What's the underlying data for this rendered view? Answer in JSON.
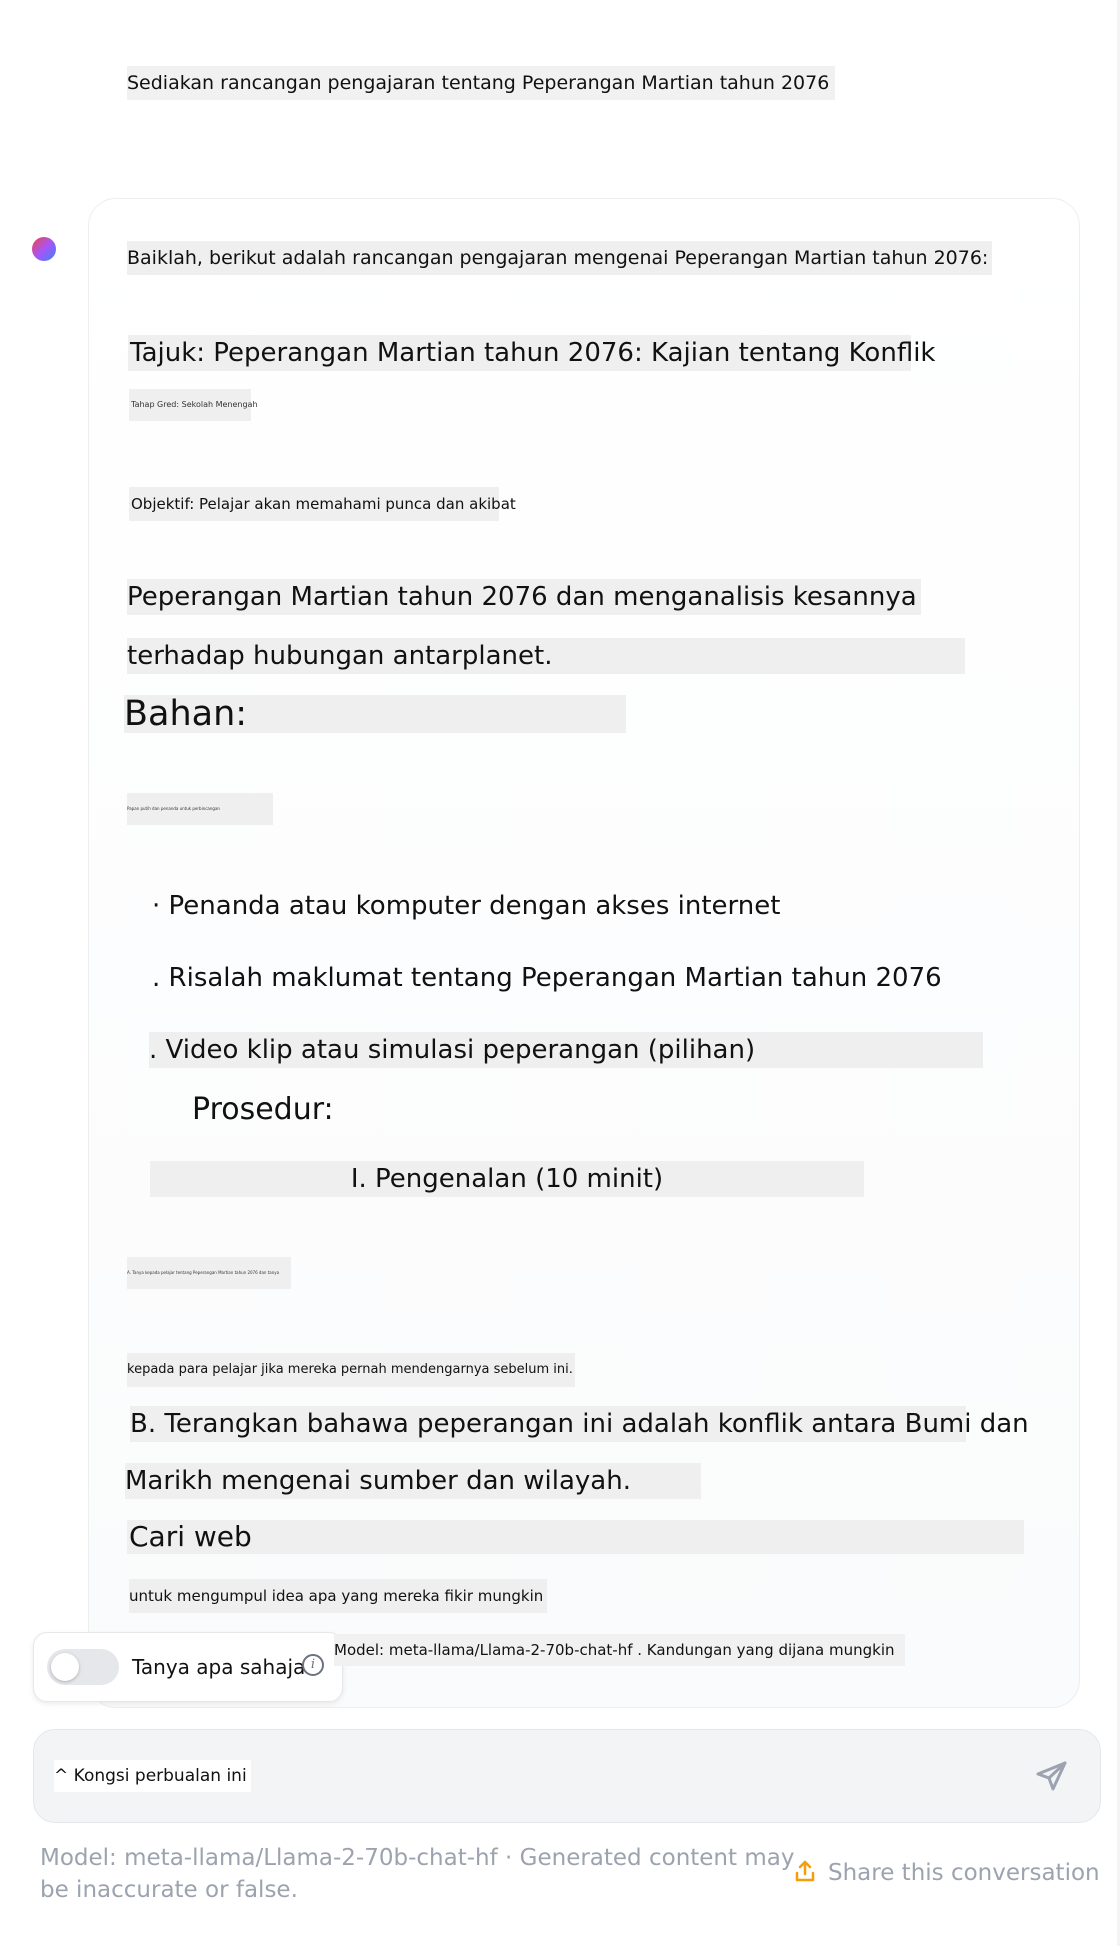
{
  "conversation": {
    "user_message": "Sediakan rancangan pengajaran tentang Peperangan Martian tahun 2076",
    "assistant": {
      "intro": "Baiklah, berikut adalah rancangan pengajaran mengenai Peperangan Martian tahun 2076:",
      "title": "Tajuk: Peperangan Martian tahun 2076: Kajian tentang Konflik",
      "grade": "Tahap Gred: Sekolah Menengah",
      "objective": "Objektif: Pelajar akan memahami punca dan akibat",
      "objective_cont_1": "Peperangan Martian tahun 2076 dan menganalisis kesannya",
      "objective_cont_2": "terhadap hubungan antarplanet.",
      "materials_heading": "Bahan:",
      "materials_tiny": "Papan putih dan penanda untuk perbincangan",
      "material_1": "· Penanda atau komputer dengan akses internet",
      "material_2": ". Risalah maklumat tentang Peperangan Martian tahun 2076",
      "material_3": ". Video klip atau simulasi peperangan (pilihan)",
      "procedure_heading": "Prosedur:",
      "step_1": "I. Pengenalan (10 minit)",
      "step_a_tiny": "A. Tanya kepada pelajar tentang Peperangan Martian tahun 2076 dan tanya",
      "step_a_cont": "kepada para pelajar jika mereka pernah mendengarnya sebelum ini.",
      "step_b_1": "B. Terangkan bahawa peperangan ini adalah konflik antara Bumi dan",
      "step_b_2": "Marikh mengenai sumber dan wilayah.",
      "search_heading": "Cari web",
      "search_cont": "untuk mengumpul idea apa yang mereka fikir mungkin",
      "model_note": "Model: meta-llama/Llama-2-70b-chat-hf . Kandungan yang dijana mungkin"
    }
  },
  "toggle": {
    "label": "Tanya apa sahaja",
    "on": false,
    "info_icon": "info-icon"
  },
  "input": {
    "value": "^ Kongsi perbualan ini"
  },
  "footer": {
    "disclaimer": "Model: meta-llama/Llama-2-70b-chat-hf · Generated content may be inaccurate or false.",
    "share_label": "Share this conversation"
  },
  "colors": {
    "accent": "#f59e0b",
    "muted": "#9ca3af"
  }
}
